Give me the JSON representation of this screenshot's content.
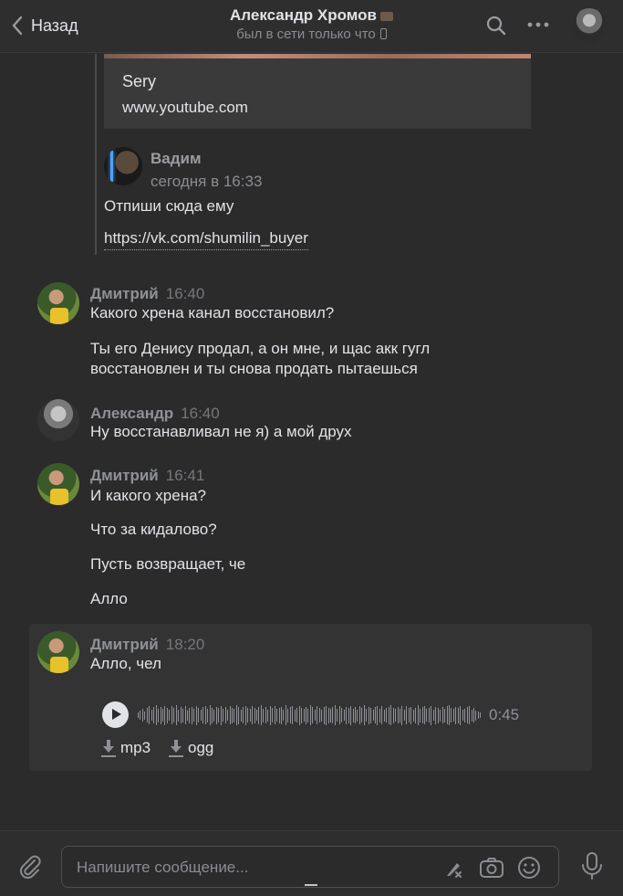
{
  "header": {
    "back_label": "Назад",
    "title": "Александр Хромов",
    "status": "был в сети только что",
    "icons": [
      "chevron-left-icon",
      "search-icon",
      "more-icon",
      "avatar"
    ]
  },
  "linkcard": {
    "title": "Sery",
    "url": "www.youtube.com"
  },
  "forwarded": {
    "name": "Вадим",
    "time": "сегодня в 16:33",
    "text": "Отпиши сюда ему",
    "link": "https://vk.com/shumilin_buyer"
  },
  "messages": [
    {
      "name": "Дмитрий",
      "time": "16:40",
      "lines": [
        "Какого хрена канал восстановил?",
        "Ты его Денису продал, а он мне, и щас акк гугл",
        "восстановлен и ты снова продать пытаешься"
      ]
    },
    {
      "name": "Александр",
      "time": "16:40",
      "lines": [
        "Ну восстанавливал не я) а мой друх"
      ]
    },
    {
      "name": "Дмитрий",
      "time": "16:41",
      "lines": [
        "И какого хрена?",
        "Что за кидалово?",
        "Пусть возвращает, че",
        "Алло"
      ]
    },
    {
      "name": "Дмитрий",
      "time": "18:20",
      "lines": [
        "Алло, чел"
      ]
    }
  ],
  "voice": {
    "duration": "0:45",
    "download_mp3": "mp3",
    "download_ogg": "ogg",
    "waveform": [
      6,
      10,
      14,
      9,
      16,
      20,
      12,
      18,
      22,
      15,
      19,
      14,
      21,
      17,
      12,
      20,
      16,
      22,
      13,
      18,
      15,
      20,
      11,
      17,
      19,
      14,
      21,
      16,
      12,
      18,
      20,
      15,
      22,
      17,
      13,
      19,
      16,
      21,
      14,
      18,
      12,
      20,
      17,
      15,
      22,
      19,
      13,
      18,
      21,
      16,
      14,
      20,
      17,
      12,
      19,
      22,
      15,
      18,
      13,
      21,
      16,
      20,
      14,
      17,
      19,
      12,
      22,
      15,
      18,
      20,
      13,
      16,
      21,
      17,
      14,
      19,
      15,
      22,
      18,
      12,
      20,
      16,
      13,
      19,
      21,
      17,
      15,
      18,
      22,
      14,
      20,
      16,
      12,
      19,
      17,
      21,
      15,
      18,
      13,
      20,
      16,
      22,
      14,
      19,
      17,
      12,
      18,
      21,
      15,
      20,
      13,
      16,
      19,
      22,
      17,
      14,
      18,
      15,
      21,
      12,
      20,
      16,
      19,
      13,
      17,
      22,
      15,
      18,
      20,
      14,
      16,
      21,
      12,
      19,
      17,
      13,
      18,
      15,
      20,
      22,
      16,
      14,
      19,
      17,
      21,
      12,
      15,
      18,
      20,
      13,
      16,
      11,
      8,
      6
    ]
  },
  "composer": {
    "placeholder": "Напишите сообщение...",
    "icons": [
      "paperclip-icon",
      "sticker-edit-icon",
      "camera-icon",
      "emoji-icon",
      "microphone-icon"
    ]
  }
}
